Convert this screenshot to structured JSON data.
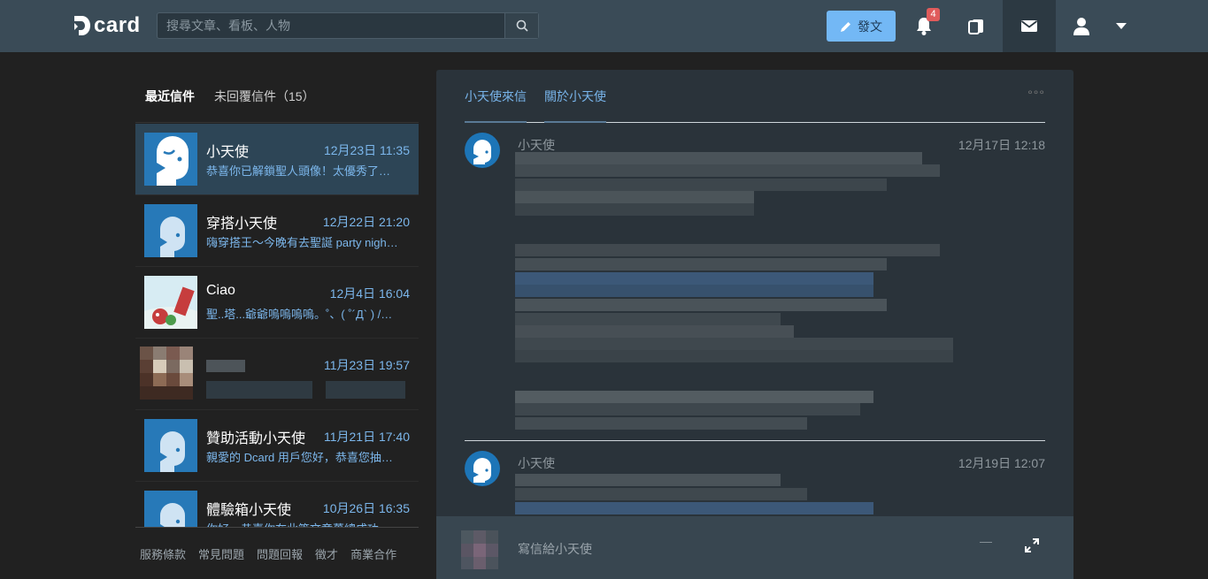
{
  "nav": {
    "logo_text": "card",
    "search_placeholder": "搜尋文章、看板、人物",
    "post_button": "發文",
    "notification_count": "4",
    "icons": [
      "search-icon",
      "pencil-icon",
      "bell-icon",
      "cards-icon",
      "mail-icon",
      "user-icon",
      "caret-down-icon"
    ]
  },
  "sidebar": {
    "tabs": [
      {
        "label": "最近信件",
        "active": true
      },
      {
        "label": "未回覆信件（15）",
        "active": false
      }
    ],
    "items": [
      {
        "name": "小天使",
        "time": "12月23日 11:35",
        "preview": "恭喜你已解鎖聖人頭像！太優秀了…"
      },
      {
        "name": "穿搭小天使",
        "time": "12月22日 21:20",
        "preview": "嗨穿搭王～今晚有去聖誕 party nigh…"
      },
      {
        "name": "Ciao",
        "time": "12月4日 16:04",
        "preview": "聖..塔...爺爺嗚嗚嗚嗚。˚、( ˚´Д` ) /…"
      },
      {
        "name": "",
        "time": "11月23日 19:57",
        "preview": ""
      },
      {
        "name": "贊助活動小天使",
        "time": "11月21日 17:40",
        "preview": "親愛的 Dcard 用戶您好，恭喜您抽…"
      },
      {
        "name": "體驗箱小天使",
        "time": "10月26日 16:35",
        "preview": "你好～恭喜你在此篇文章萬總成功…"
      }
    ],
    "footer_links": [
      "服務條款",
      "常見問題",
      "問題回報",
      "徵才",
      "商業合作"
    ]
  },
  "panel": {
    "tabs": [
      "小天使來信",
      "關於小天使"
    ],
    "more_label": "°°°",
    "messages": [
      {
        "author": "小天使",
        "time": "12月17日 12:18"
      },
      {
        "author": "小天使",
        "time": "12月19日 12:07"
      }
    ],
    "composer_placeholder": "寫信給小天使",
    "minimize_label": "—"
  },
  "colors": {
    "navbar": "#3a4b57",
    "accent_blue": "#7cb7ec",
    "post_button": "#73b8f5",
    "badge": "#e05b5b",
    "active_item": "#2d4556"
  }
}
